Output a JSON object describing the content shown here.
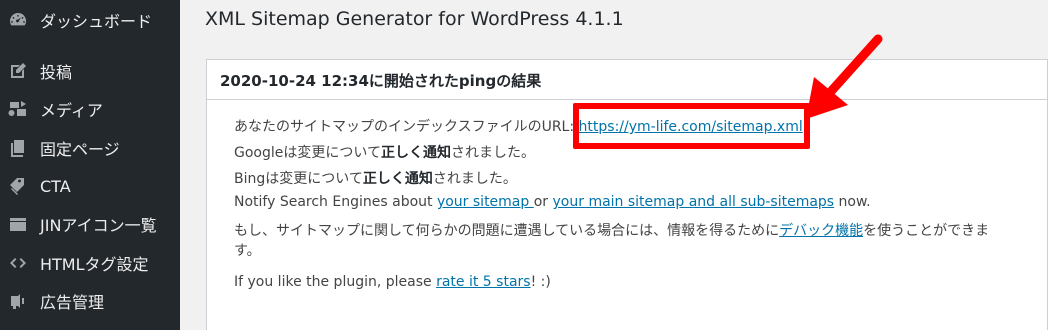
{
  "sidebar": {
    "items": [
      {
        "label": "ダッシュボード",
        "icon": "dashboard-icon"
      },
      {
        "label": "投稿",
        "icon": "pushpin-icon"
      },
      {
        "label": "メディア",
        "icon": "media-icon"
      },
      {
        "label": "固定ページ",
        "icon": "pages-icon"
      },
      {
        "label": "CTA",
        "icon": "tag-icon"
      },
      {
        "label": "JINアイコン一覧",
        "icon": "list-icon"
      },
      {
        "label": "HTMLタグ設定",
        "icon": "code-icon"
      },
      {
        "label": "広告管理",
        "icon": "megaphone-icon"
      }
    ]
  },
  "main": {
    "title": "XML Sitemap Generator for WordPress 4.1.1",
    "panel": {
      "title": "2020-10-24 12:34に開始されたpingの結果",
      "line1": {
        "prefix": "あなたのサイトマップのインデックスファイルのURL: ",
        "link": "https://ym-life.com/sitemap.xml"
      },
      "line2": {
        "prefix": "Googleは変更について",
        "bold1": "正しく通知",
        "suffix": "されました。"
      },
      "line3": {
        "prefix": "Bingは変更について",
        "bold1": "正しく通知",
        "suffix": "されました。"
      },
      "line4": {
        "prefix": "Notify Search Engines about ",
        "link1": "your sitemap ",
        "middle": "or ",
        "link2": "your main sitemap and all sub-sitemaps",
        "suffix": " now."
      },
      "line5": {
        "prefix": "もし、サイトマップに関して何らかの問題に遭遇している場合には、情報を得るために",
        "link": "デバック機能",
        "suffix": "を使うことができま"
      },
      "line5b": "す。",
      "line6": {
        "prefix": "If you like the plugin, please ",
        "link": "rate it 5 stars",
        "suffix": "! :)"
      }
    }
  },
  "colors": {
    "sidebar_bg": "#23282d",
    "link": "#0073aa",
    "annotation": "#ff0000"
  }
}
